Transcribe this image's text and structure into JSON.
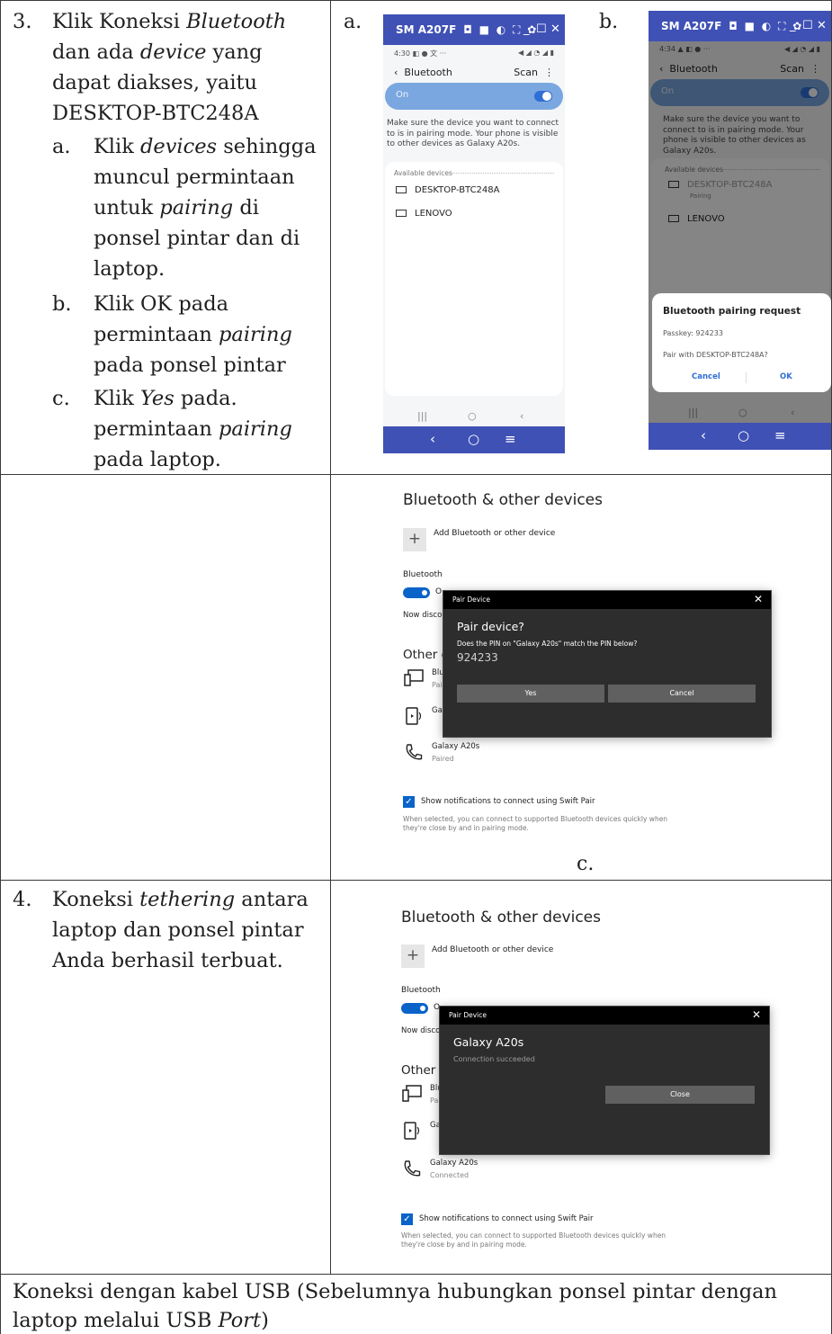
{
  "step3": {
    "number": "3.",
    "line1_pre": "Klik Koneksi ",
    "line1_em": "Bluetooth",
    "line2_pre": "dan ada ",
    "line2_em": "device",
    "line2_post": " yang",
    "line3": "dapat diakses, yaitu",
    "line4": "DESKTOP-BTC248A",
    "sub_a_label": "a.",
    "sub_a_line1_pre": "Klik ",
    "sub_a_line1_em": "devices",
    "sub_a_line1_post": " sehingga",
    "sub_a_line2": "muncul permintaan",
    "sub_a_line3_pre": "untuk ",
    "sub_a_line3_em": "pairing",
    "sub_a_line3_post": " di",
    "sub_a_line4": "ponsel pintar dan di",
    "sub_a_line5": "laptop.",
    "sub_b_label": "b.",
    "sub_b_line1": "Klik OK pada",
    "sub_b_line2_pre": "permintaan ",
    "sub_b_line2_em": "pairing",
    "sub_b_line3": "pada ponsel pintar",
    "sub_c_label": "c.",
    "sub_c_line1_pre": "Klik ",
    "sub_c_line1_em": "Yes",
    "sub_c_line1_post": " pada.",
    "sub_c_line2_pre": "permintaan ",
    "sub_c_line2_em": "pairing",
    "sub_c_line3": "pada laptop."
  },
  "step4": {
    "number": "4.",
    "line1_pre": "Koneksi ",
    "line1_em": "tethering",
    "line1_post": " antara",
    "line2": "laptop dan ponsel pintar",
    "line3": "Anda berhasil terbuat."
  },
  "footer": {
    "line1": "Koneksi dengan kabel USB (Sebelumnya hubungkan ponsel pintar dengan",
    "line2_pre": "laptop melalui USB ",
    "line2_em": "Port",
    "line2_post": ")"
  },
  "panel_letters": {
    "a": "a.",
    "b": "b.",
    "c": "c."
  },
  "phone_a": {
    "title": "SM A207F",
    "title_icons": "◘ ■ ◐ ⛶ ✿",
    "win_min": "_",
    "win_max": "☐",
    "win_close": "✕",
    "status_left": "4:30 ◧ ● 文 ···",
    "status_right": "◀ ◢ ◔ ◢ ▮",
    "back_arrow": "‹",
    "header": "Bluetooth",
    "scan": "Scan",
    "menu": "⋮",
    "on_label": "On",
    "description": "Make sure the device you want to connect to is in pairing mode. Your phone is visible to other devices as Galaxy A20s.",
    "available": "Available devices",
    "device1": "DESKTOP-BTC248A",
    "device2": "LENOVO",
    "sys_recent": "|||",
    "sys_home": "○",
    "sys_back": "‹",
    "nav_back": "‹",
    "nav_home": "○",
    "nav_menu": "≡"
  },
  "phone_b": {
    "title": "SM A207F",
    "title_icons": "◘ ■ ◐ ⛶ ✿",
    "win_min": "_",
    "win_max": "☐",
    "win_close": "✕",
    "status_left": "4:34 ▲ ◧ ● ···",
    "status_right": "◀ ◢ ◔ ◢ ▮",
    "back_arrow": "‹",
    "header": "Bluetooth",
    "scan": "Scan",
    "menu": "⋮",
    "on_label": "On",
    "description": "Make sure the device you want to connect to is in pairing mode. Your phone is visible to other devices as Galaxy A20s.",
    "available": "Available devices",
    "device1": "DESKTOP-BTC248A",
    "device1_sub": "Pairing",
    "device2": "LENOVO",
    "dialog_title": "Bluetooth pairing request",
    "passkey": "Passkey: 924233",
    "pair_with": "Pair with DESKTOP-BTC248A?",
    "cancel": "Cancel",
    "ok": "OK",
    "sys_recent": "|||",
    "sys_home": "○",
    "sys_back": "‹",
    "nav_back": "‹",
    "nav_home": "○",
    "nav_menu": "≡"
  },
  "win_c": {
    "heading": "Bluetooth & other devices",
    "plus": "+",
    "add": "Add Bluetooth or other device",
    "bt_label": "Bluetooth",
    "o_text": "O",
    "now_disc": "Now disco",
    "other": "Other d",
    "dev1_name": "Blu",
    "dev1_sub": "Pai",
    "dev2_name": "Ga",
    "dev3_name": "Galaxy A20s",
    "dev3_sub": "Paired",
    "check_mark": "✓",
    "swift": "Show notifications to connect using Swift Pair",
    "note": "When selected, you can connect to supported Bluetooth devices quickly when they're close by and in pairing mode.",
    "dialog_bar": "Pair Device",
    "dialog_close": "✕",
    "dialog_heading": "Pair device?",
    "dialog_question": "Does the PIN on \"Galaxy A20s\" match the PIN below?",
    "pin": "924233",
    "yes": "Yes",
    "cancel": "Cancel"
  },
  "win_4": {
    "heading": "Bluetooth & other devices",
    "plus": "+",
    "add": "Add Bluetooth or other device",
    "bt_label": "Bluetooth",
    "o_text": "O",
    "now_disc": "Now disco",
    "other": "Other d",
    "dev1_name": "Blu",
    "dev1_sub": "Pai",
    "dev2_name": "Ga",
    "dev3_name": "Galaxy A20s",
    "dev3_sub": "Connected",
    "check_mark": "✓",
    "swift": "Show notifications to connect using Swift Pair",
    "note": "When selected, you can connect to supported Bluetooth devices quickly when they're close by and in pairing mode.",
    "dialog_bar": "Pair Device",
    "dialog_close": "✕",
    "dialog_heading": "Galaxy A20s",
    "dialog_status": "Connection succeeded",
    "close": "Close"
  }
}
